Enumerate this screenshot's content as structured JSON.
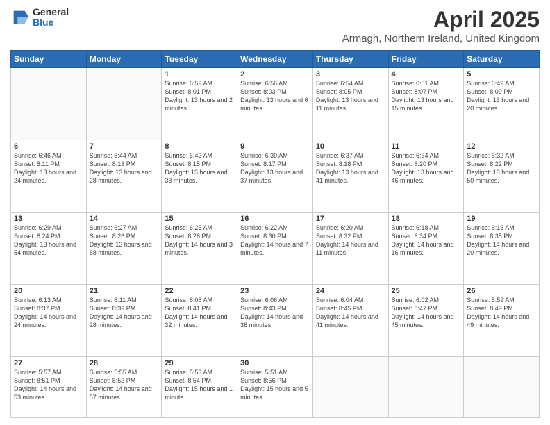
{
  "header": {
    "logo_general": "General",
    "logo_blue": "Blue",
    "title": "April 2025",
    "subtitle": "Armagh, Northern Ireland, United Kingdom"
  },
  "days_of_week": [
    "Sunday",
    "Monday",
    "Tuesday",
    "Wednesday",
    "Thursday",
    "Friday",
    "Saturday"
  ],
  "weeks": [
    [
      {
        "day": "",
        "info": ""
      },
      {
        "day": "",
        "info": ""
      },
      {
        "day": "1",
        "info": "Sunrise: 6:59 AM\nSunset: 8:01 PM\nDaylight: 13 hours and 2 minutes."
      },
      {
        "day": "2",
        "info": "Sunrise: 6:56 AM\nSunset: 8:03 PM\nDaylight: 13 hours and 6 minutes."
      },
      {
        "day": "3",
        "info": "Sunrise: 6:54 AM\nSunset: 8:05 PM\nDaylight: 13 hours and 11 minutes."
      },
      {
        "day": "4",
        "info": "Sunrise: 6:51 AM\nSunset: 8:07 PM\nDaylight: 13 hours and 15 minutes."
      },
      {
        "day": "5",
        "info": "Sunrise: 6:49 AM\nSunset: 8:09 PM\nDaylight: 13 hours and 20 minutes."
      }
    ],
    [
      {
        "day": "6",
        "info": "Sunrise: 6:46 AM\nSunset: 8:11 PM\nDaylight: 13 hours and 24 minutes."
      },
      {
        "day": "7",
        "info": "Sunrise: 6:44 AM\nSunset: 8:13 PM\nDaylight: 13 hours and 28 minutes."
      },
      {
        "day": "8",
        "info": "Sunrise: 6:42 AM\nSunset: 8:15 PM\nDaylight: 13 hours and 33 minutes."
      },
      {
        "day": "9",
        "info": "Sunrise: 6:39 AM\nSunset: 8:17 PM\nDaylight: 13 hours and 37 minutes."
      },
      {
        "day": "10",
        "info": "Sunrise: 6:37 AM\nSunset: 8:18 PM\nDaylight: 13 hours and 41 minutes."
      },
      {
        "day": "11",
        "info": "Sunrise: 6:34 AM\nSunset: 8:20 PM\nDaylight: 13 hours and 46 minutes."
      },
      {
        "day": "12",
        "info": "Sunrise: 6:32 AM\nSunset: 8:22 PM\nDaylight: 13 hours and 50 minutes."
      }
    ],
    [
      {
        "day": "13",
        "info": "Sunrise: 6:29 AM\nSunset: 8:24 PM\nDaylight: 13 hours and 54 minutes."
      },
      {
        "day": "14",
        "info": "Sunrise: 6:27 AM\nSunset: 8:26 PM\nDaylight: 13 hours and 58 minutes."
      },
      {
        "day": "15",
        "info": "Sunrise: 6:25 AM\nSunset: 8:28 PM\nDaylight: 14 hours and 3 minutes."
      },
      {
        "day": "16",
        "info": "Sunrise: 6:22 AM\nSunset: 8:30 PM\nDaylight: 14 hours and 7 minutes."
      },
      {
        "day": "17",
        "info": "Sunrise: 6:20 AM\nSunset: 8:32 PM\nDaylight: 14 hours and 11 minutes."
      },
      {
        "day": "18",
        "info": "Sunrise: 6:18 AM\nSunset: 8:34 PM\nDaylight: 14 hours and 16 minutes."
      },
      {
        "day": "19",
        "info": "Sunrise: 6:15 AM\nSunset: 8:35 PM\nDaylight: 14 hours and 20 minutes."
      }
    ],
    [
      {
        "day": "20",
        "info": "Sunrise: 6:13 AM\nSunset: 8:37 PM\nDaylight: 14 hours and 24 minutes."
      },
      {
        "day": "21",
        "info": "Sunrise: 6:11 AM\nSunset: 8:39 PM\nDaylight: 14 hours and 28 minutes."
      },
      {
        "day": "22",
        "info": "Sunrise: 6:08 AM\nSunset: 8:41 PM\nDaylight: 14 hours and 32 minutes."
      },
      {
        "day": "23",
        "info": "Sunrise: 6:06 AM\nSunset: 8:43 PM\nDaylight: 14 hours and 36 minutes."
      },
      {
        "day": "24",
        "info": "Sunrise: 6:04 AM\nSunset: 8:45 PM\nDaylight: 14 hours and 41 minutes."
      },
      {
        "day": "25",
        "info": "Sunrise: 6:02 AM\nSunset: 8:47 PM\nDaylight: 14 hours and 45 minutes."
      },
      {
        "day": "26",
        "info": "Sunrise: 5:59 AM\nSunset: 8:49 PM\nDaylight: 14 hours and 49 minutes."
      }
    ],
    [
      {
        "day": "27",
        "info": "Sunrise: 5:57 AM\nSunset: 8:51 PM\nDaylight: 14 hours and 53 minutes."
      },
      {
        "day": "28",
        "info": "Sunrise: 5:55 AM\nSunset: 8:52 PM\nDaylight: 14 hours and 57 minutes."
      },
      {
        "day": "29",
        "info": "Sunrise: 5:53 AM\nSunset: 8:54 PM\nDaylight: 15 hours and 1 minute."
      },
      {
        "day": "30",
        "info": "Sunrise: 5:51 AM\nSunset: 8:56 PM\nDaylight: 15 hours and 5 minutes."
      },
      {
        "day": "",
        "info": ""
      },
      {
        "day": "",
        "info": ""
      },
      {
        "day": "",
        "info": ""
      }
    ]
  ]
}
